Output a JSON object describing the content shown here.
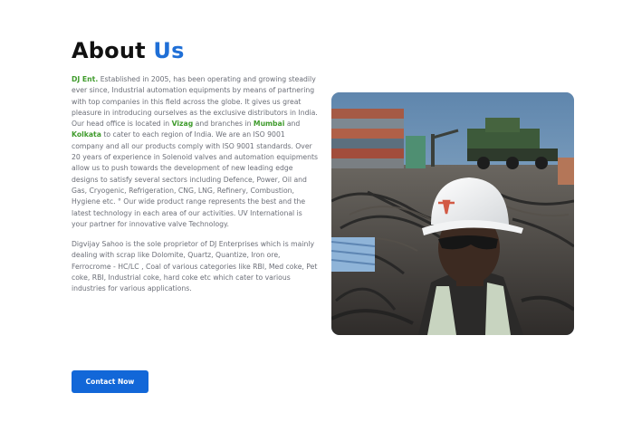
{
  "heading": {
    "part1": "About",
    "part2": "Us"
  },
  "intro": {
    "company": "DJ Ent.",
    "t1": " Established in 2005, has been operating and growing steadily ever since, Industrial automation equipments by means of partnering with top companies in this field across the globe. It gives us great pleasure in introducing ourselves as the exclusive distributors in India. Our head office is located in ",
    "city1": "Vizag",
    "t2": " and branches in ",
    "city2": "Mumbai",
    "t3": " and ",
    "city3": "Kolkata",
    "t4": " to cater to each region of India. We are an ISO 9001 company and all our products comply with ISO 9001 standards. Over 20 years of experience in Solenoid valves and automation equipments allow us to push towards the development of new leading edge designs to satisfy several sectors including Defence, Power, Oil and Gas, Cryogenic, Refrigeration, CNG, LNG, Refinery, Combustion, Hygiene etc. ° Our wide product range represents the best and the latest technology in each area of our activities. UV International is your partner for innovative valve Technology."
  },
  "second_paragraph": "Digvijay Sahoo is the sole proprietor of DJ Enterprises which is mainly dealing with scrap like Dolomite, Quartz, Quantize, Iron ore, Ferrocrome - HC/LC , Coal of various categories like RBI, Med coke, Pet coke, RBI, Industrial coke, hard coke etc which cater to various industries for various applications.",
  "contact_button": {
    "label": "Contact Now"
  },
  "colors": {
    "accent_blue": "#1f6fd6",
    "highlight_green": "#3f9b2c",
    "button_blue": "#1267d8",
    "body_text": "#6c6f78"
  }
}
